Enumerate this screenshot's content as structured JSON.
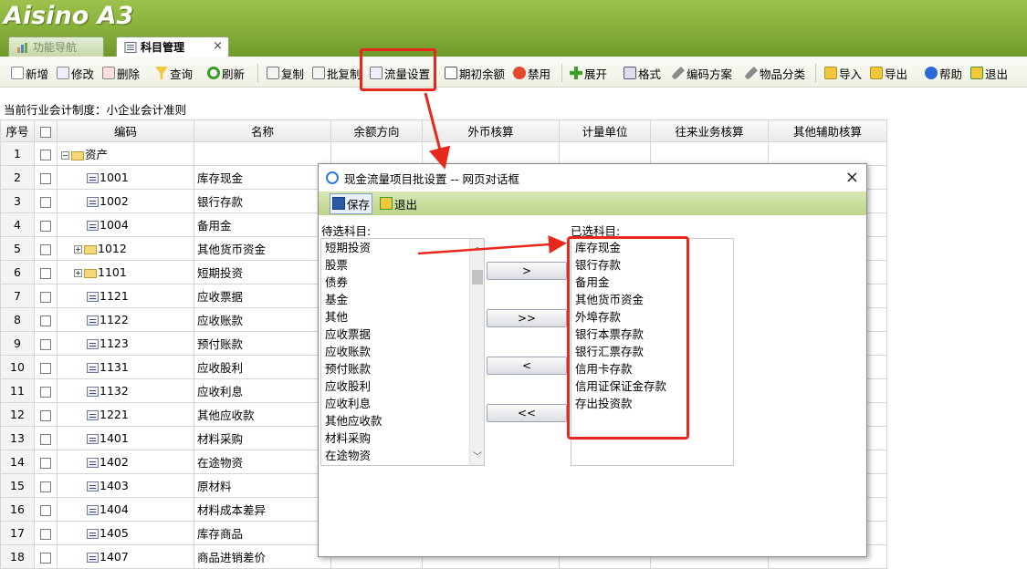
{
  "app": {
    "logo": "Aisino A3"
  },
  "tabs": [
    {
      "label": "功能导航"
    },
    {
      "label": "科目管理",
      "close": "×"
    }
  ],
  "toolbar": [
    {
      "label": "新增",
      "icon": "new-icon"
    },
    {
      "label": "修改",
      "icon": "edit-icon"
    },
    {
      "label": "删除",
      "icon": "delete-icon"
    },
    {
      "label": "查询",
      "icon": "filter-icon"
    },
    {
      "label": "刷新",
      "icon": "refresh-icon"
    },
    {
      "label": "复制",
      "icon": "copy-icon"
    },
    {
      "label": "批复制",
      "icon": "batch-copy-icon"
    },
    {
      "label": "流量设置",
      "icon": "flow-settings-icon"
    },
    {
      "label": "期初余额",
      "icon": "opening-balance-icon"
    },
    {
      "label": "禁用",
      "icon": "disable-icon"
    },
    {
      "label": "展开",
      "icon": "expand-icon"
    },
    {
      "label": "格式",
      "icon": "format-icon"
    },
    {
      "label": "编码方案",
      "icon": "wrench-icon"
    },
    {
      "label": "物品分类",
      "icon": "wrench-icon"
    },
    {
      "label": "导入",
      "icon": "import-icon"
    },
    {
      "label": "导出",
      "icon": "export-icon"
    },
    {
      "label": "帮助",
      "icon": "help-icon"
    },
    {
      "label": "退出",
      "icon": "exit-icon"
    }
  ],
  "policy_text": "当前行业会计制度：小企业会计准则",
  "grid": {
    "headers": [
      "序号",
      "",
      "编码",
      "名称",
      "余额方向",
      "外币核算",
      "计量单位",
      "往来业务核算",
      "其他辅助核算"
    ],
    "rows": [
      {
        "no": "1",
        "code": "资产",
        "name": "",
        "type": "folder-open"
      },
      {
        "no": "2",
        "code": "1001",
        "name": "库存现金",
        "type": "leaf"
      },
      {
        "no": "3",
        "code": "1002",
        "name": "银行存款",
        "type": "leaf"
      },
      {
        "no": "4",
        "code": "1004",
        "name": "备用金",
        "type": "leaf"
      },
      {
        "no": "5",
        "code": "1012",
        "name": "其他货币资金",
        "type": "folder"
      },
      {
        "no": "6",
        "code": "1101",
        "name": "短期投资",
        "type": "folder"
      },
      {
        "no": "7",
        "code": "1121",
        "name": "应收票据",
        "type": "leaf"
      },
      {
        "no": "8",
        "code": "1122",
        "name": "应收账款",
        "type": "leaf"
      },
      {
        "no": "9",
        "code": "1123",
        "name": "预付账款",
        "type": "leaf"
      },
      {
        "no": "10",
        "code": "1131",
        "name": "应收股利",
        "type": "leaf"
      },
      {
        "no": "11",
        "code": "1132",
        "name": "应收利息",
        "type": "leaf"
      },
      {
        "no": "12",
        "code": "1221",
        "name": "其他应收款",
        "type": "leaf"
      },
      {
        "no": "13",
        "code": "1401",
        "name": "材料采购",
        "type": "leaf"
      },
      {
        "no": "14",
        "code": "1402",
        "name": "在途物资",
        "type": "leaf"
      },
      {
        "no": "15",
        "code": "1403",
        "name": "原材料",
        "type": "leaf"
      },
      {
        "no": "16",
        "code": "1404",
        "name": "材料成本差异",
        "type": "leaf"
      },
      {
        "no": "17",
        "code": "1405",
        "name": "库存商品",
        "type": "leaf"
      },
      {
        "no": "18",
        "code": "1407",
        "name": "商品进销差价",
        "type": "leaf"
      }
    ]
  },
  "dialog": {
    "title": "现金流量项目批设置 -- 网页对话框",
    "close": "×",
    "save_label": "保存",
    "exit_label": "退出",
    "left_label": "待选科目:",
    "right_label": "已选科目:",
    "candidates": [
      "短期投资",
      "股票",
      "债券",
      "基金",
      "其他",
      "应收票据",
      "应收账款",
      "预付账款",
      "应收股利",
      "应收利息",
      "其他应收款",
      "材料采购",
      "在途物资"
    ],
    "selected": [
      "库存现金",
      "银行存款",
      "备用金",
      "其他货币资金",
      "外埠存款",
      "银行本票存款",
      "银行汇票存款",
      "信用卡存款",
      "信用证保证金存款",
      "存出投资款"
    ],
    "buttons": [
      ">",
      ">>",
      "<",
      "<<"
    ]
  },
  "colors": {
    "header_green": "#83ad38",
    "annotation_red": "#e8281d"
  }
}
